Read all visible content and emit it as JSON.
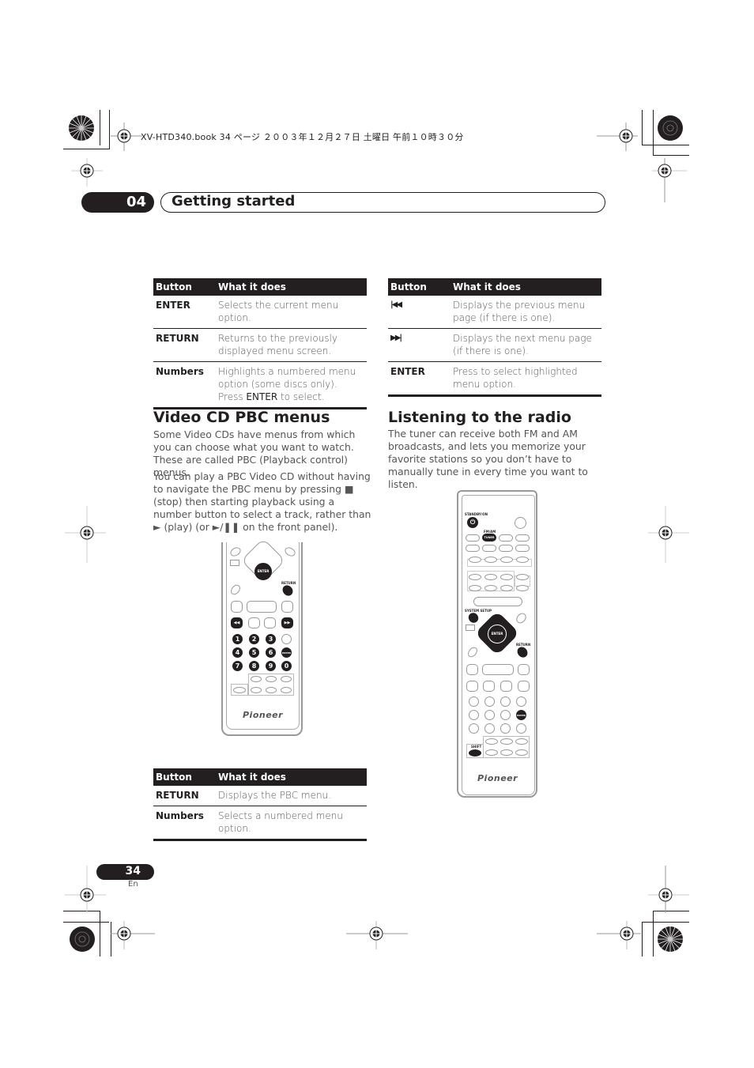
{
  "book_header": "XV-HTD340.book  34 ページ  ２００３年１２月２７日  土曜日  午前１０時３０分",
  "chapter": {
    "number": "04",
    "title": "Getting started"
  },
  "table_enter_return": {
    "headers": [
      "Button",
      "What it does"
    ],
    "rows": [
      {
        "button": "ENTER",
        "text": "Selects the current menu option."
      },
      {
        "button": "RETURN",
        "text": "Returns to the previously displayed menu screen."
      },
      {
        "button": "Numbers",
        "text_before": "Highlights a numbered menu option (some discs only). Press ",
        "text_bold": "ENTER",
        "text_after": " to select."
      }
    ]
  },
  "table_skip": {
    "headers": [
      "Button",
      "What it does"
    ],
    "rows": [
      {
        "button": "|◀◀",
        "icon": "previous-icon",
        "text": "Displays the previous menu page (if there is one)."
      },
      {
        "button": "▶▶|",
        "icon": "next-icon",
        "text": "Displays the next menu page (if there is one)."
      },
      {
        "button": "ENTER",
        "text": "Press to select highlighted menu option."
      }
    ]
  },
  "section_vcd": {
    "heading": "Video CD PBC menus",
    "para1": "Some Video CDs have menus from which you can choose what you want to watch. These are called PBC (Playback control) menus.",
    "para2": "You can play a PBC Video CD without having to navigate the PBC menu by pressing ■ (stop) then starting playback using a number button to select a track, rather than ► (play) (or ►/❚❚ on the front panel)."
  },
  "section_radio": {
    "heading": "Listening to the radio",
    "para1": "The tuner can receive both FM and AM broadcasts, and lets you memorize your favorite stations so you don’t have to manually tune in every time you want to listen."
  },
  "table_pbc": {
    "headers": [
      "Button",
      "What it does"
    ],
    "rows": [
      {
        "button": "RETURN",
        "text": "Displays the PBC menu."
      },
      {
        "button": "Numbers",
        "text": "Selects a numbered menu option."
      }
    ]
  },
  "remote_small": {
    "labels": {
      "enter": "ENTER",
      "return": "RETURN",
      "prev": "◀◀",
      "next": "▶▶",
      "enter2": "ENTER",
      "brand": "Pioneer"
    },
    "numbers": [
      "1",
      "2",
      "3",
      "4",
      "5",
      "6",
      "7",
      "8",
      "9",
      "0"
    ]
  },
  "remote_large": {
    "labels": {
      "standby": "STANDBY/ON",
      "fm_am": "FM/AM",
      "tuner": "TUNER",
      "system_setup": "SYSTEM SETUP",
      "enter": "ENTER",
      "return": "RETURN",
      "enter2": "ENTER",
      "shift": "SHIFT",
      "brand": "Pioneer",
      "power": "⏻"
    }
  },
  "footer": {
    "page_number": "34",
    "language": "En"
  }
}
